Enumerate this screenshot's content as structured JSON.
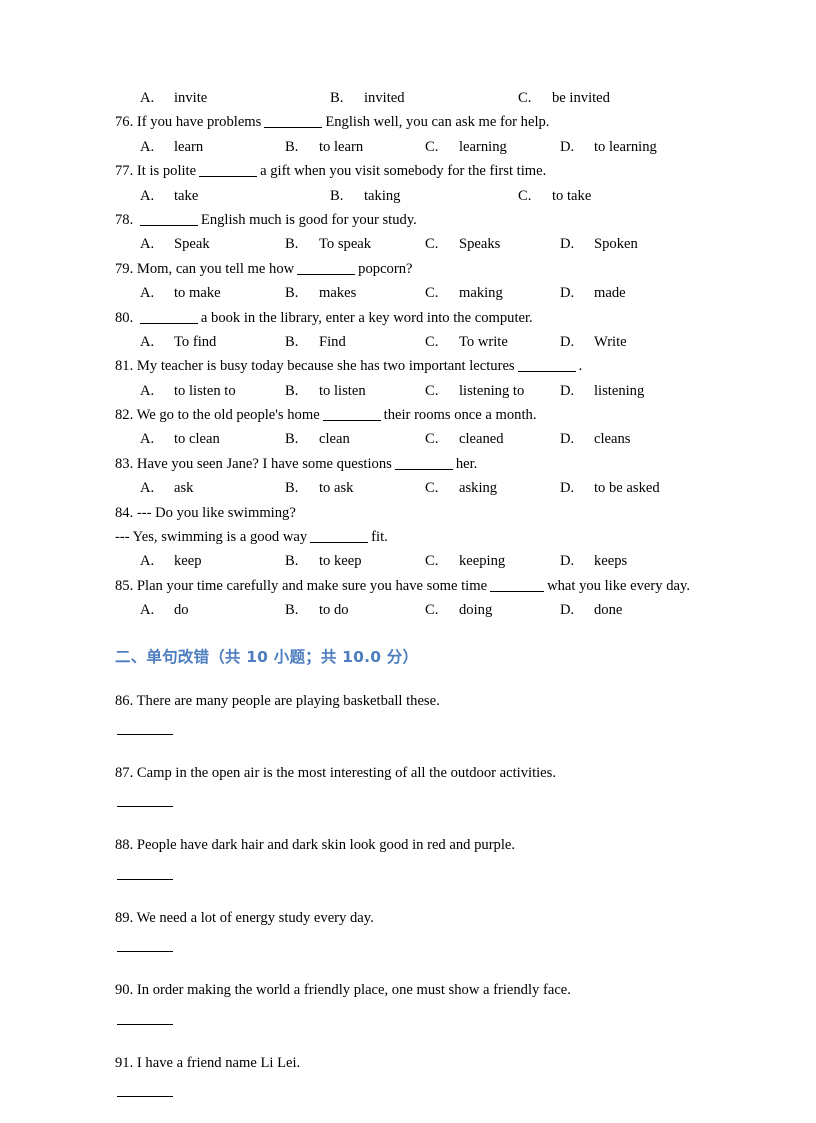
{
  "document": {
    "colors": {
      "heading_blue": "#4d7ebf",
      "text": "#000000",
      "background": "#ffffff"
    }
  },
  "multiple_choice": {
    "orphan_options": {
      "labels": [
        "A.",
        "B.",
        "C."
      ],
      "values": [
        "invite",
        "invited",
        "be invited"
      ]
    },
    "questions": [
      {
        "number": "76.",
        "stem_before": "If you have problems",
        "stem_after": "English well, you can ask me for help.",
        "labels": [
          "A.",
          "B.",
          "C.",
          "D."
        ],
        "options": [
          "learn",
          "to learn",
          "learning",
          "to learning"
        ]
      },
      {
        "number": "77.",
        "stem_before": "It is polite",
        "stem_after": "a gift when you visit somebody for the first time.",
        "labels": [
          "A.",
          "B.",
          "C."
        ],
        "options": [
          "take",
          "taking",
          "to take"
        ]
      },
      {
        "number": "78.",
        "stem_before": "",
        "stem_after": "English much is good for your study.",
        "labels": [
          "A.",
          "B.",
          "C.",
          "D."
        ],
        "options": [
          "Speak",
          "To speak",
          "Speaks",
          "Spoken"
        ]
      },
      {
        "number": "79.",
        "stem_before": "Mom, can you tell me how",
        "stem_after": "popcorn?",
        "labels": [
          "A.",
          "B.",
          "C.",
          "D."
        ],
        "options": [
          "to make",
          "makes",
          "making",
          "made"
        ]
      },
      {
        "number": "80.",
        "stem_before": "",
        "stem_after": "a book in the library, enter a key word into the computer.",
        "labels": [
          "A.",
          "B.",
          "C.",
          "D."
        ],
        "options": [
          "To find",
          "Find",
          "To write",
          "Write"
        ]
      },
      {
        "number": "81.",
        "stem_before": "My teacher is busy today because she has two important lectures",
        "stem_after": ".",
        "labels": [
          "A.",
          "B.",
          "C.",
          "D."
        ],
        "options": [
          "to listen to",
          "to listen",
          "listening to",
          "listening"
        ]
      },
      {
        "number": "82.",
        "stem_before": "We go to the old people's home",
        "stem_after": "their rooms once a month.",
        "labels": [
          "A.",
          "B.",
          "C.",
          "D."
        ],
        "options": [
          "to clean",
          "clean",
          "cleaned",
          "cleans"
        ]
      },
      {
        "number": "83.",
        "stem_before": "Have you seen Jane? I have some questions",
        "stem_after": "her.",
        "labels": [
          "A.",
          "B.",
          "C.",
          "D."
        ],
        "options": [
          "ask",
          "to ask",
          "asking",
          "to be asked"
        ]
      },
      {
        "number": "84.",
        "stem_before": "--- Do you like swimming?",
        "stem_after": "",
        "continuation_before": "--- Yes, swimming is a good way",
        "continuation_after": "fit.",
        "labels": [
          "A.",
          "B.",
          "C.",
          "D."
        ],
        "options": [
          "keep",
          "to keep",
          "keeping",
          "keeps"
        ]
      },
      {
        "number": "85.",
        "stem_before": "Plan your time carefully and make sure you have some time",
        "stem_after": "what you like every day.",
        "labels": [
          "A.",
          "B.",
          "C.",
          "D."
        ],
        "options": [
          "do",
          "to do",
          "doing",
          "done"
        ]
      }
    ]
  },
  "section_two": {
    "heading": "二、单句改错（共 10 小题；共 10.0 分）",
    "items": [
      {
        "number": "86.",
        "text": "There are many people are playing basketball these."
      },
      {
        "number": "87.",
        "text": "Camp in the open air is the most interesting of all the outdoor activities."
      },
      {
        "number": "88.",
        "text": "People have dark hair and dark skin look good in red and purple."
      },
      {
        "number": "89.",
        "text": "We need a lot of energy study every day."
      },
      {
        "number": "90.",
        "text": "In order making the world a friendly place, one must show a friendly face."
      },
      {
        "number": "91.",
        "text": "I have a friend name Li Lei."
      }
    ]
  }
}
